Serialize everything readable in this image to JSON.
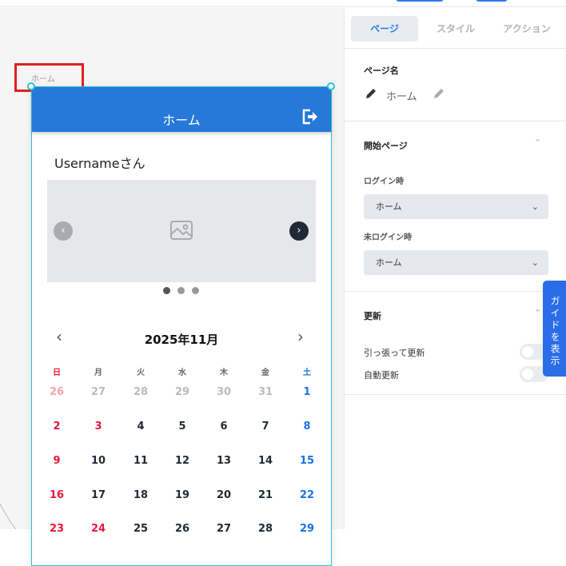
{
  "canvas": {
    "frame_label": "ホーム",
    "app_bar_title": "ホーム",
    "greeting": "Usernameさん",
    "carousel": {
      "prev": "‹",
      "next": "›",
      "dots": 3,
      "active_dot": 0
    },
    "calendar": {
      "title": "2025年11月",
      "prev": "‹",
      "next": "›",
      "weekdays": [
        "日",
        "月",
        "火",
        "水",
        "木",
        "金",
        "土"
      ],
      "weeks": [
        [
          "26",
          "27",
          "28",
          "29",
          "30",
          "31",
          "1"
        ],
        [
          "2",
          "3",
          "4",
          "5",
          "6",
          "7",
          "8"
        ],
        [
          "9",
          "10",
          "11",
          "12",
          "13",
          "14",
          "15"
        ],
        [
          "16",
          "17",
          "18",
          "19",
          "20",
          "21",
          "22"
        ],
        [
          "23",
          "24",
          "25",
          "26",
          "27",
          "28",
          "29"
        ]
      ]
    }
  },
  "panel": {
    "tabs": [
      {
        "label": "ページ"
      },
      {
        "label": "スタイル"
      },
      {
        "label": "アクション"
      }
    ],
    "page_name_label": "ページ名",
    "page_name": "ホーム",
    "start_page": {
      "title": "開始ページ",
      "login_label": "ログイン時",
      "login_value": "ホーム",
      "logout_label": "未ログイン時",
      "logout_value": "ホーム"
    },
    "refresh": {
      "title": "更新",
      "pull_label": "引っ張って更新",
      "pull_on": false,
      "auto_label": "自動更新",
      "auto_on": false
    },
    "guide_button": "ガイドを表示"
  },
  "colors": {
    "primary": "#2678d9",
    "sunday": "#e8173c",
    "saturday": "#1a73e8",
    "accent": "#2b7de9"
  }
}
